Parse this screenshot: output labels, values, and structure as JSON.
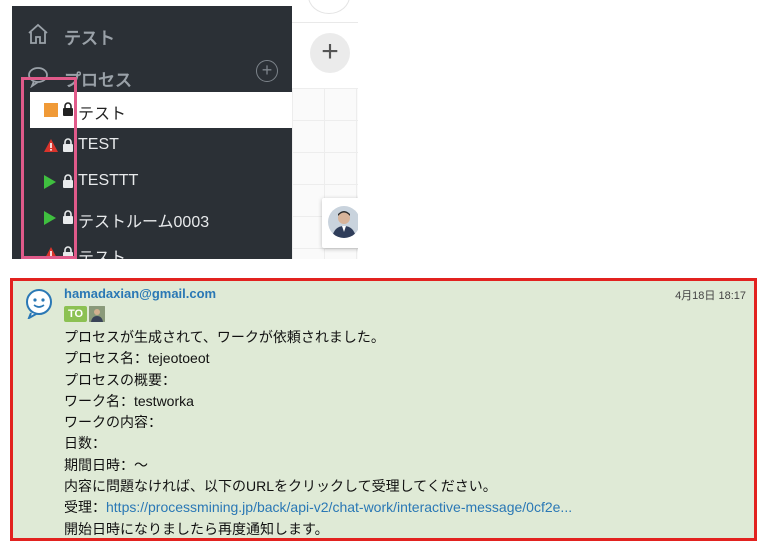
{
  "sidebar": {
    "home_label": "テスト",
    "process_label": "プロセス",
    "add_symbol": "+",
    "rooms": [
      {
        "name": "テスト",
        "status": "orange-square",
        "selected": true
      },
      {
        "name": "TEST",
        "status": "warning",
        "selected": false
      },
      {
        "name": "TESTTT",
        "status": "play",
        "selected": false
      },
      {
        "name": "テストルーム0003",
        "status": "play",
        "selected": false
      },
      {
        "name": "テスト",
        "status": "warning",
        "selected": false
      }
    ]
  },
  "right_pane": {
    "plus_symbol": "+"
  },
  "message": {
    "sender": "hamadaxian@gmail.com",
    "timestamp": "4月18日 18:17",
    "to_badge": "TO",
    "lines": [
      "プロセスが生成されて、ワークが依頼されました。",
      "プロセス名：tejeotoeot",
      "プロセスの概要：",
      "ワーク名：testworka",
      "ワークの内容：",
      "日数：",
      "期間日時：〜",
      "内容に問題なければ、以下のURLをクリックして受理してください。"
    ],
    "accept_label": "受理：",
    "accept_url": "https://processmining.jp/back/api-v2/chat-work/interactive-message/0cf2e...",
    "footer_line": "開始日時になりましたら再度通知します。"
  },
  "colors": {
    "sidebar_bg": "#2b3036",
    "highlight_pink": "#e05a8a",
    "message_bg": "#dfead6",
    "message_border": "#e2221f",
    "link": "#2a78b5",
    "to_badge": "#8cc153"
  }
}
